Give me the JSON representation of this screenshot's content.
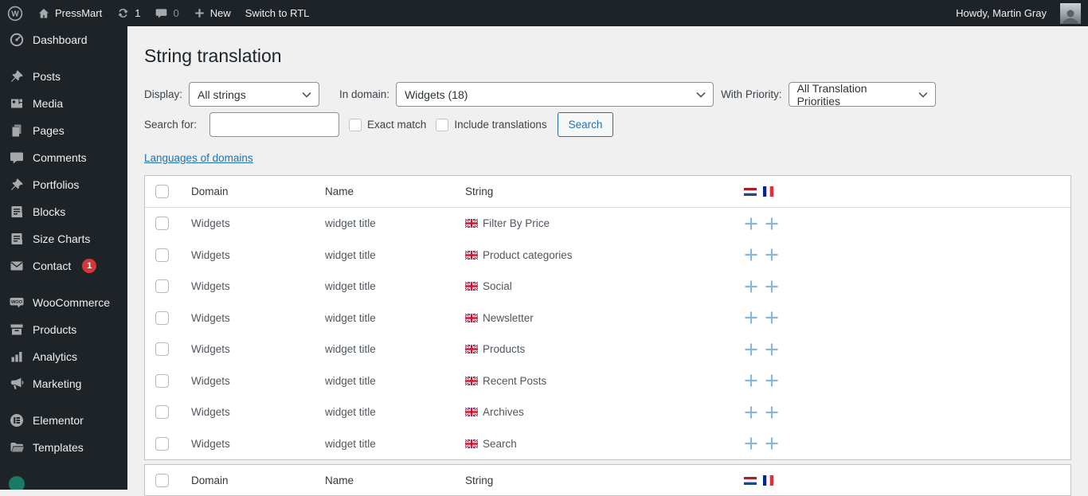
{
  "admin_bar": {
    "site_name": "PressMart",
    "updates_count": "1",
    "comments_count": "0",
    "new_label": "New",
    "rtl_label": "Switch to RTL",
    "howdy": "Howdy, Martin Gray"
  },
  "sidebar": {
    "items": [
      {
        "label": "Dashboard",
        "icon": "dashboard-icon"
      },
      {
        "label": "Posts",
        "icon": "pushpin-icon"
      },
      {
        "label": "Media",
        "icon": "media-icon"
      },
      {
        "label": "Pages",
        "icon": "pages-icon"
      },
      {
        "label": "Comments",
        "icon": "comment-icon"
      },
      {
        "label": "Portfolios",
        "icon": "pushpin-icon"
      },
      {
        "label": "Blocks",
        "icon": "document-icon"
      },
      {
        "label": "Size Charts",
        "icon": "document-icon"
      },
      {
        "label": "Contact",
        "icon": "envelope-icon",
        "badge": "1"
      },
      {
        "label": "WooCommerce",
        "icon": "woocommerce-icon"
      },
      {
        "label": "Products",
        "icon": "archive-box-icon"
      },
      {
        "label": "Analytics",
        "icon": "bar-chart-icon"
      },
      {
        "label": "Marketing",
        "icon": "megaphone-icon"
      },
      {
        "label": "Elementor",
        "icon": "elementor-icon"
      },
      {
        "label": "Templates",
        "icon": "folder-icon"
      }
    ]
  },
  "main": {
    "title": "String translation",
    "filters": {
      "display_label": "Display:",
      "display_value": "All strings",
      "domain_label": "In domain:",
      "domain_value": "Widgets (18)",
      "priority_label": "With Priority:",
      "priority_value": "All Translation Priorities"
    },
    "search": {
      "label": "Search for:",
      "value": "",
      "placeholder": "",
      "exact_match_label": "Exact match",
      "include_translations_label": "Include translations",
      "button_label": "Search"
    },
    "languages_link": "Languages of domains"
  },
  "table": {
    "headers": {
      "domain": "Domain",
      "name": "Name",
      "string": "String"
    },
    "languages": [
      {
        "name": "Dutch",
        "flag": "nl-flag"
      },
      {
        "name": "French",
        "flag": "fr-flag"
      }
    ],
    "rows": [
      {
        "domain": "Widgets",
        "name": "widget title",
        "string": "Filter By Price",
        "string_flag": "en-flag"
      },
      {
        "domain": "Widgets",
        "name": "widget title",
        "string": "Product categories",
        "string_flag": "en-flag"
      },
      {
        "domain": "Widgets",
        "name": "widget title",
        "string": "Social",
        "string_flag": "en-flag"
      },
      {
        "domain": "Widgets",
        "name": "widget title",
        "string": "Newsletter",
        "string_flag": "en-flag"
      },
      {
        "domain": "Widgets",
        "name": "widget title",
        "string": "Products",
        "string_flag": "en-flag"
      },
      {
        "domain": "Widgets",
        "name": "widget title",
        "string": "Recent Posts",
        "string_flag": "en-flag"
      },
      {
        "domain": "Widgets",
        "name": "widget title",
        "string": "Archives",
        "string_flag": "en-flag"
      },
      {
        "domain": "Widgets",
        "name": "widget title",
        "string": "Search",
        "string_flag": "en-flag"
      }
    ]
  },
  "colors": {
    "accent_blue": "#2271b1",
    "admin_dark": "#1d2327",
    "badge_red": "#d63638",
    "plus_icon_blue": "#8ab7d9",
    "page_background": "#f0f0f1"
  }
}
